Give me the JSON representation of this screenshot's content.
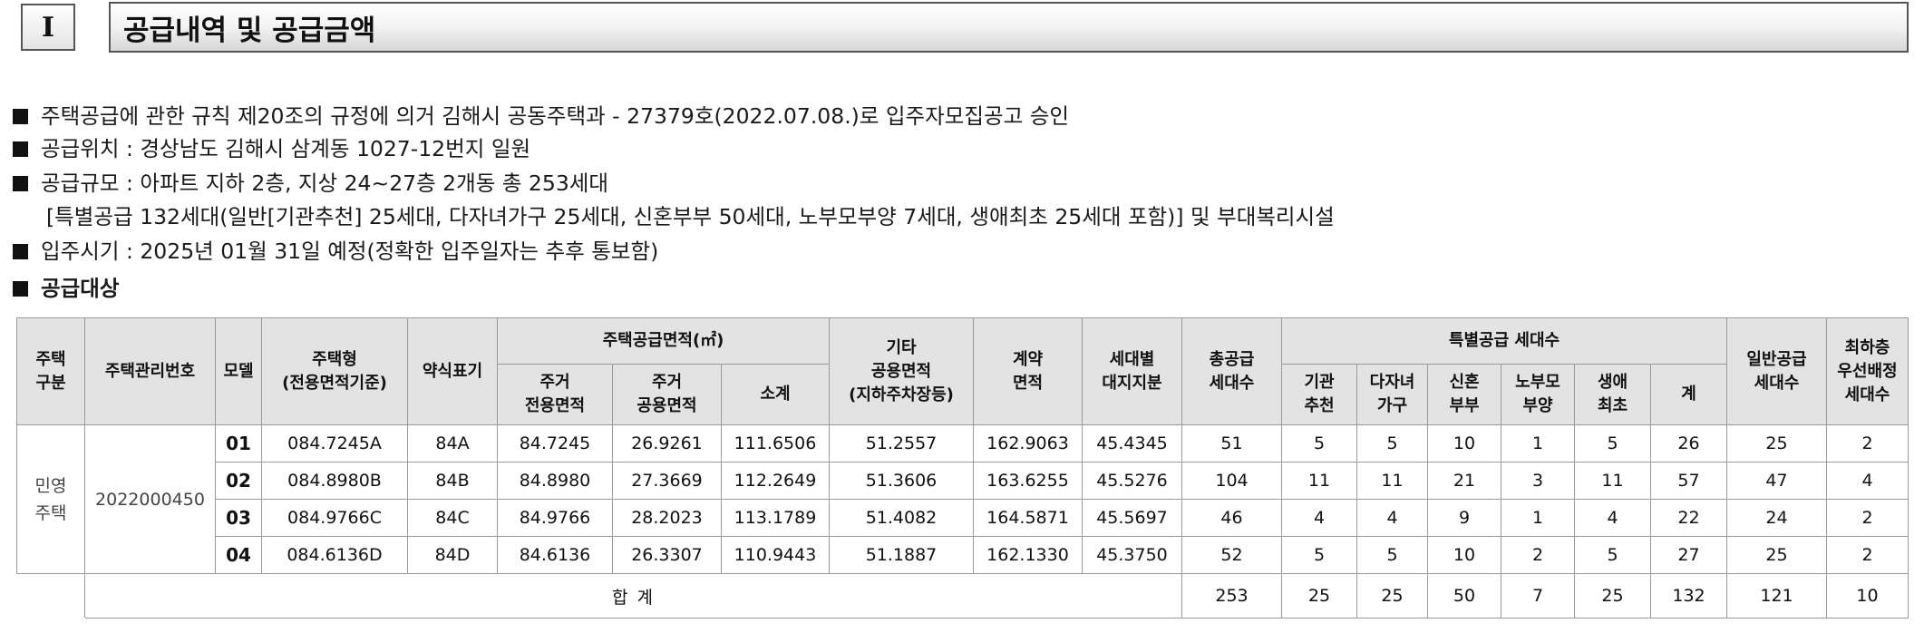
{
  "section": {
    "number": "I",
    "title": "공급내역 및 공급금액"
  },
  "info": [
    "주택공급에 관한 규칙 제20조의 규정에 의거 김해시 공동주택과 - 27379호(2022.07.08.)로 입주자모집공고 승인",
    "공급위치 : 경상남도 김해시 삼계동 1027-12번지 일원",
    "공급규모 : 아파트 지하 2층, 지상 24~27층 2개동 총 253세대",
    "[특별공급 132세대(일반[기관추천] 25세대, 다자녀가구 25세대, 신혼부부 50세대, 노부모부양 7세대, 생애최초 25세대 포함)] 및 부대복리시설",
    "입주시기 : 2025년 01월 31일 예정(정확한 입주일자는 추후 통보함)",
    "공급대상"
  ],
  "table": {
    "headers": {
      "kind": [
        "주택",
        "구분"
      ],
      "mgmt_no": "주택관리번호",
      "model": "모델",
      "type": [
        "주택형",
        "(전용면적기준)"
      ],
      "abbr": "약식표기",
      "area_group": "주택공급면적(㎡)",
      "area_exclusive": [
        "주거",
        "전용면적"
      ],
      "area_common": [
        "주거",
        "공용면적"
      ],
      "area_subtotal": "소계",
      "other_common": [
        "기타",
        "공용면적",
        "(지하주차장등)"
      ],
      "contract": [
        "계약",
        "면적"
      ],
      "land": [
        "세대별",
        "대지지분"
      ],
      "total_units": [
        "총공급",
        "세대수"
      ],
      "special_group": "특별공급 세대수",
      "sp_institution": [
        "기관",
        "추천"
      ],
      "sp_multichild": [
        "다자녀",
        "가구"
      ],
      "sp_newlywed": [
        "신혼",
        "부부"
      ],
      "sp_parents": [
        "노부모",
        "부양"
      ],
      "sp_first": [
        "생애",
        "최초"
      ],
      "sp_sum": "계",
      "general": [
        "일반공급",
        "세대수"
      ],
      "lowest_floor": [
        "최하층",
        "우선배정",
        "세대수"
      ]
    },
    "kind_value": [
      "민영",
      "주택"
    ],
    "mgmt_no_value": "2022000450",
    "rows": [
      {
        "model": "01",
        "type": "084.7245A",
        "abbr": "84A",
        "excl": "84.7245",
        "common": "26.9261",
        "sub": "111.6506",
        "other": "51.2557",
        "contract": "162.9063",
        "land": "45.4345",
        "total": "51",
        "inst": "5",
        "multi": "5",
        "newly": "10",
        "parents": "1",
        "first": "5",
        "sp_sum": "26",
        "general": "25",
        "lowest": "2"
      },
      {
        "model": "02",
        "type": "084.8980B",
        "abbr": "84B",
        "excl": "84.8980",
        "common": "27.3669",
        "sub": "112.2649",
        "other": "51.3606",
        "contract": "163.6255",
        "land": "45.5276",
        "total": "104",
        "inst": "11",
        "multi": "11",
        "newly": "21",
        "parents": "3",
        "first": "11",
        "sp_sum": "57",
        "general": "47",
        "lowest": "4"
      },
      {
        "model": "03",
        "type": "084.9766C",
        "abbr": "84C",
        "excl": "84.9766",
        "common": "28.2023",
        "sub": "113.1789",
        "other": "51.4082",
        "contract": "164.5871",
        "land": "45.5697",
        "total": "46",
        "inst": "4",
        "multi": "4",
        "newly": "9",
        "parents": "1",
        "first": "4",
        "sp_sum": "22",
        "general": "24",
        "lowest": "2"
      },
      {
        "model": "04",
        "type": "084.6136D",
        "abbr": "84D",
        "excl": "84.6136",
        "common": "26.3307",
        "sub": "110.9443",
        "other": "51.1887",
        "contract": "162.1330",
        "land": "45.3750",
        "total": "52",
        "inst": "5",
        "multi": "5",
        "newly": "10",
        "parents": "2",
        "first": "5",
        "sp_sum": "27",
        "general": "25",
        "lowest": "2"
      }
    ],
    "total": {
      "label": "합 계",
      "total": "253",
      "inst": "25",
      "multi": "25",
      "newly": "50",
      "parents": "7",
      "first": "25",
      "sp_sum": "132",
      "general": "121",
      "lowest": "10"
    }
  }
}
